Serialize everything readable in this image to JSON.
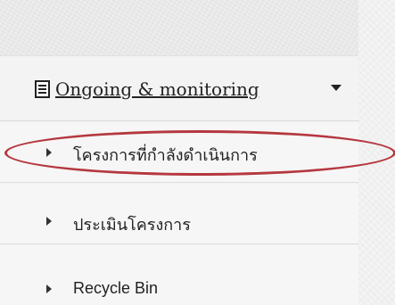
{
  "sidebar": {
    "section": {
      "icon": "document-icon",
      "label": "Ongoing & monitoring",
      "expand_icon": "caret-down-icon"
    },
    "items": [
      {
        "label": "โครงการที่กำลังดำเนินการ",
        "icon": "caret-right-icon",
        "highlighted": true
      },
      {
        "label": "ประเมินโครงการ",
        "icon": "caret-right-icon"
      },
      {
        "label": "Recycle Bin",
        "icon": "caret-right-icon"
      }
    ]
  },
  "colors": {
    "highlight_ring": "#b5383f",
    "text": "#222222",
    "background": "#f3f3f3"
  }
}
